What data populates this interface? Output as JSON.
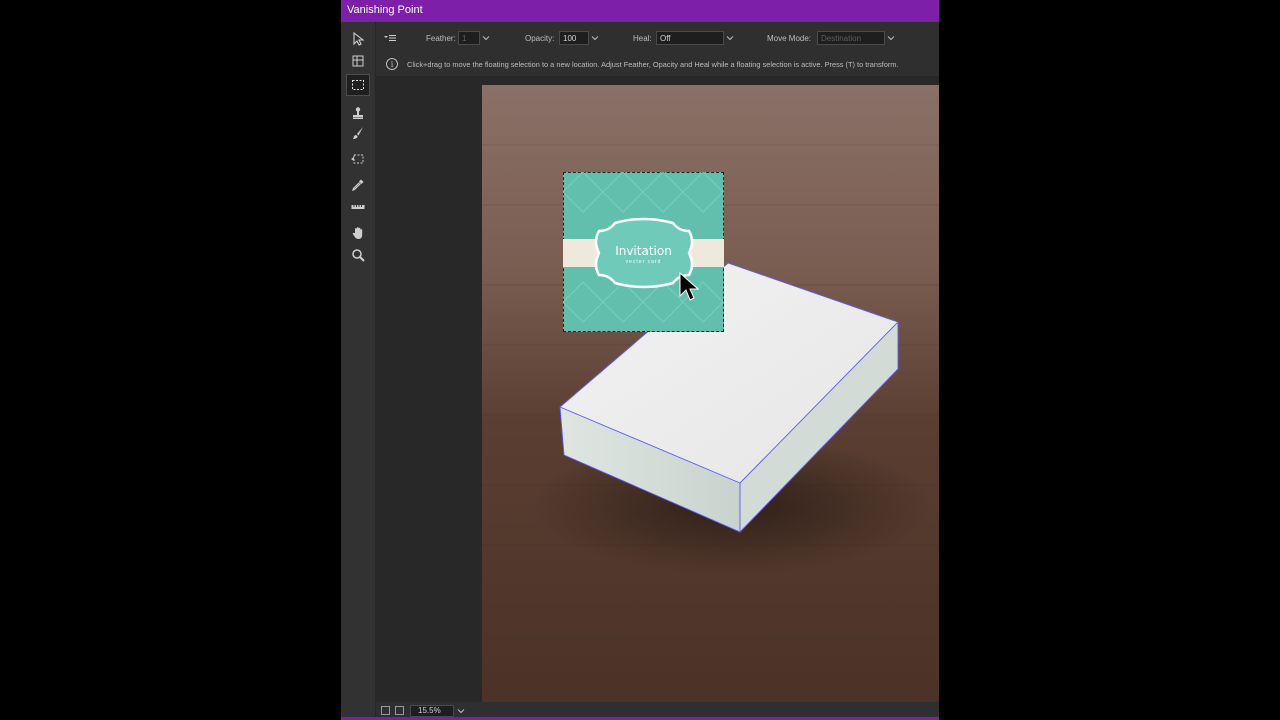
{
  "window": {
    "title": "Vanishing Point"
  },
  "tools": [
    {
      "name": "edit-plane-tool-icon"
    },
    {
      "name": "create-plane-tool-icon"
    },
    {
      "name": "marquee-tool-icon",
      "active": true
    },
    {
      "name": "stamp-tool-icon"
    },
    {
      "name": "brush-tool-icon"
    },
    {
      "name": "transform-tool-icon"
    },
    {
      "name": "eyedropper-tool-icon"
    },
    {
      "name": "measure-tool-icon"
    },
    {
      "name": "hand-tool-icon"
    },
    {
      "name": "zoom-tool-icon"
    }
  ],
  "options": {
    "feather_label": "Feather:",
    "feather_value": "1",
    "opacity_label": "Opacity:",
    "opacity_value": "100",
    "heal_label": "Heal:",
    "heal_value": "Off",
    "move_mode_label": "Move Mode:",
    "move_mode_value": "Destination"
  },
  "hint": {
    "text": "Click+drag to move the floating selection to a new location. Adjust Feather, Opacity and Heal while a floating selection is active. Press (T) to transform."
  },
  "card": {
    "title": "Invitation",
    "subtitle": "vector card"
  },
  "status": {
    "zoom": "15.5%"
  },
  "colors": {
    "titlebar": "#7d1fa8",
    "panel": "#2b2b2b",
    "card_teal": "#62bfae",
    "plane_line": "#5a5aff"
  }
}
